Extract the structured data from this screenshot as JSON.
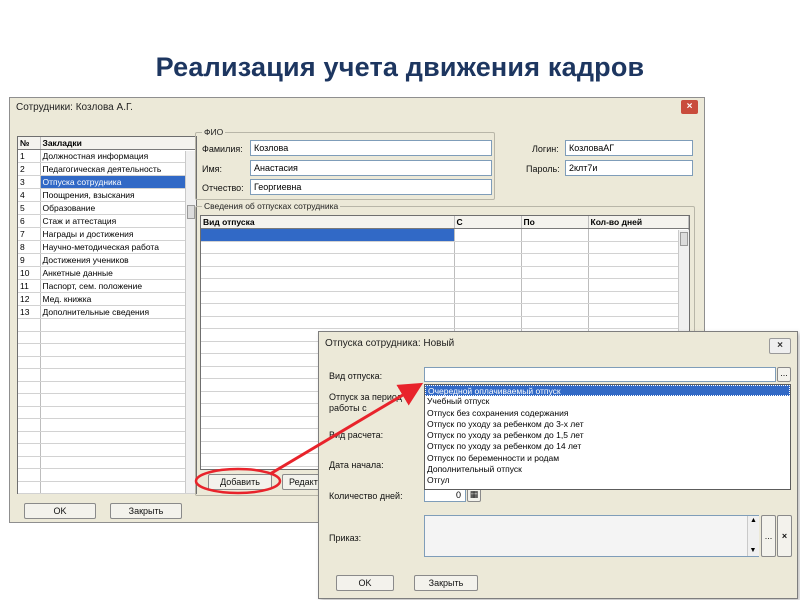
{
  "slide": {
    "title": "Реализация учета движения кадров"
  },
  "main_window": {
    "title": "Сотрудники: Козлова А.Г.",
    "close_label": "×",
    "bookmarks": {
      "headers": [
        "№",
        "Закладки"
      ],
      "rows": [
        {
          "num": "1",
          "label": "Должностная информация"
        },
        {
          "num": "2",
          "label": "Педагогическая деятельность"
        },
        {
          "num": "3",
          "label": "Отпуска сотрудника"
        },
        {
          "num": "4",
          "label": "Поощрения, взыскания"
        },
        {
          "num": "5",
          "label": "Образование"
        },
        {
          "num": "6",
          "label": "Стаж и аттестация"
        },
        {
          "num": "7",
          "label": "Награды и достижения"
        },
        {
          "num": "8",
          "label": "Научно-методическая работа"
        },
        {
          "num": "9",
          "label": "Достижения учеников"
        },
        {
          "num": "10",
          "label": "Анкетные данные"
        },
        {
          "num": "11",
          "label": "Паспорт, сем. положение"
        },
        {
          "num": "12",
          "label": "Мед. книжка"
        },
        {
          "num": "13",
          "label": "Дополнительные сведения"
        }
      ],
      "selected_index": 2
    },
    "fio": {
      "legend": "ФИО",
      "surname_label": "Фамилия:",
      "surname": "Козлова",
      "name_label": "Имя:",
      "name": "Анастасия",
      "patronymic_label": "Отчество:",
      "patronymic": "Георгиевна"
    },
    "login": {
      "login_label": "Логин:",
      "login": "КозловаАГ",
      "password_label": "Пароль:",
      "password": "2клт7и"
    },
    "vacations": {
      "legend": "Сведения об отпусках сотрудника",
      "headers": [
        "Вид отпуска",
        "С",
        "По",
        "Кол-во дней"
      ]
    },
    "buttons": {
      "add": "Добавить",
      "edit": "Редакт",
      "ok": "OK",
      "close": "Закрыть"
    }
  },
  "dialog": {
    "title": "Отпуска сотрудника: Новый",
    "close_label": "×",
    "vacation_type_label": "Вид отпуска:",
    "browse_label": "...",
    "options": [
      "Очередной оплачиваемый отпуск",
      "Учебный отпуск",
      "Отпуск без сохранения содержания",
      "Отпуск по уходу за ребенком до 3-х лет",
      "Отпуск по уходу за ребенком до 1,5 лет",
      "Отпуск по уходу за ребенком до 14 лет",
      "Отпуск по беременности и родам",
      "Дополнительный отпуск",
      "Отгул"
    ],
    "highlighted_index": 0,
    "period_label": "Отпуск за период\nработы с",
    "calc_label": "Вид расчета:",
    "start_label": "Дата начала:",
    "days_label": "Количество дней:",
    "days_value": "0",
    "order_label": "Приказ:",
    "order_browse": "...",
    "order_clear": "×",
    "ok": "OK",
    "close": "Закрыть"
  },
  "colors": {
    "title": "#1d3660",
    "selection": "#3169c6",
    "annotation": "#e8232b"
  }
}
